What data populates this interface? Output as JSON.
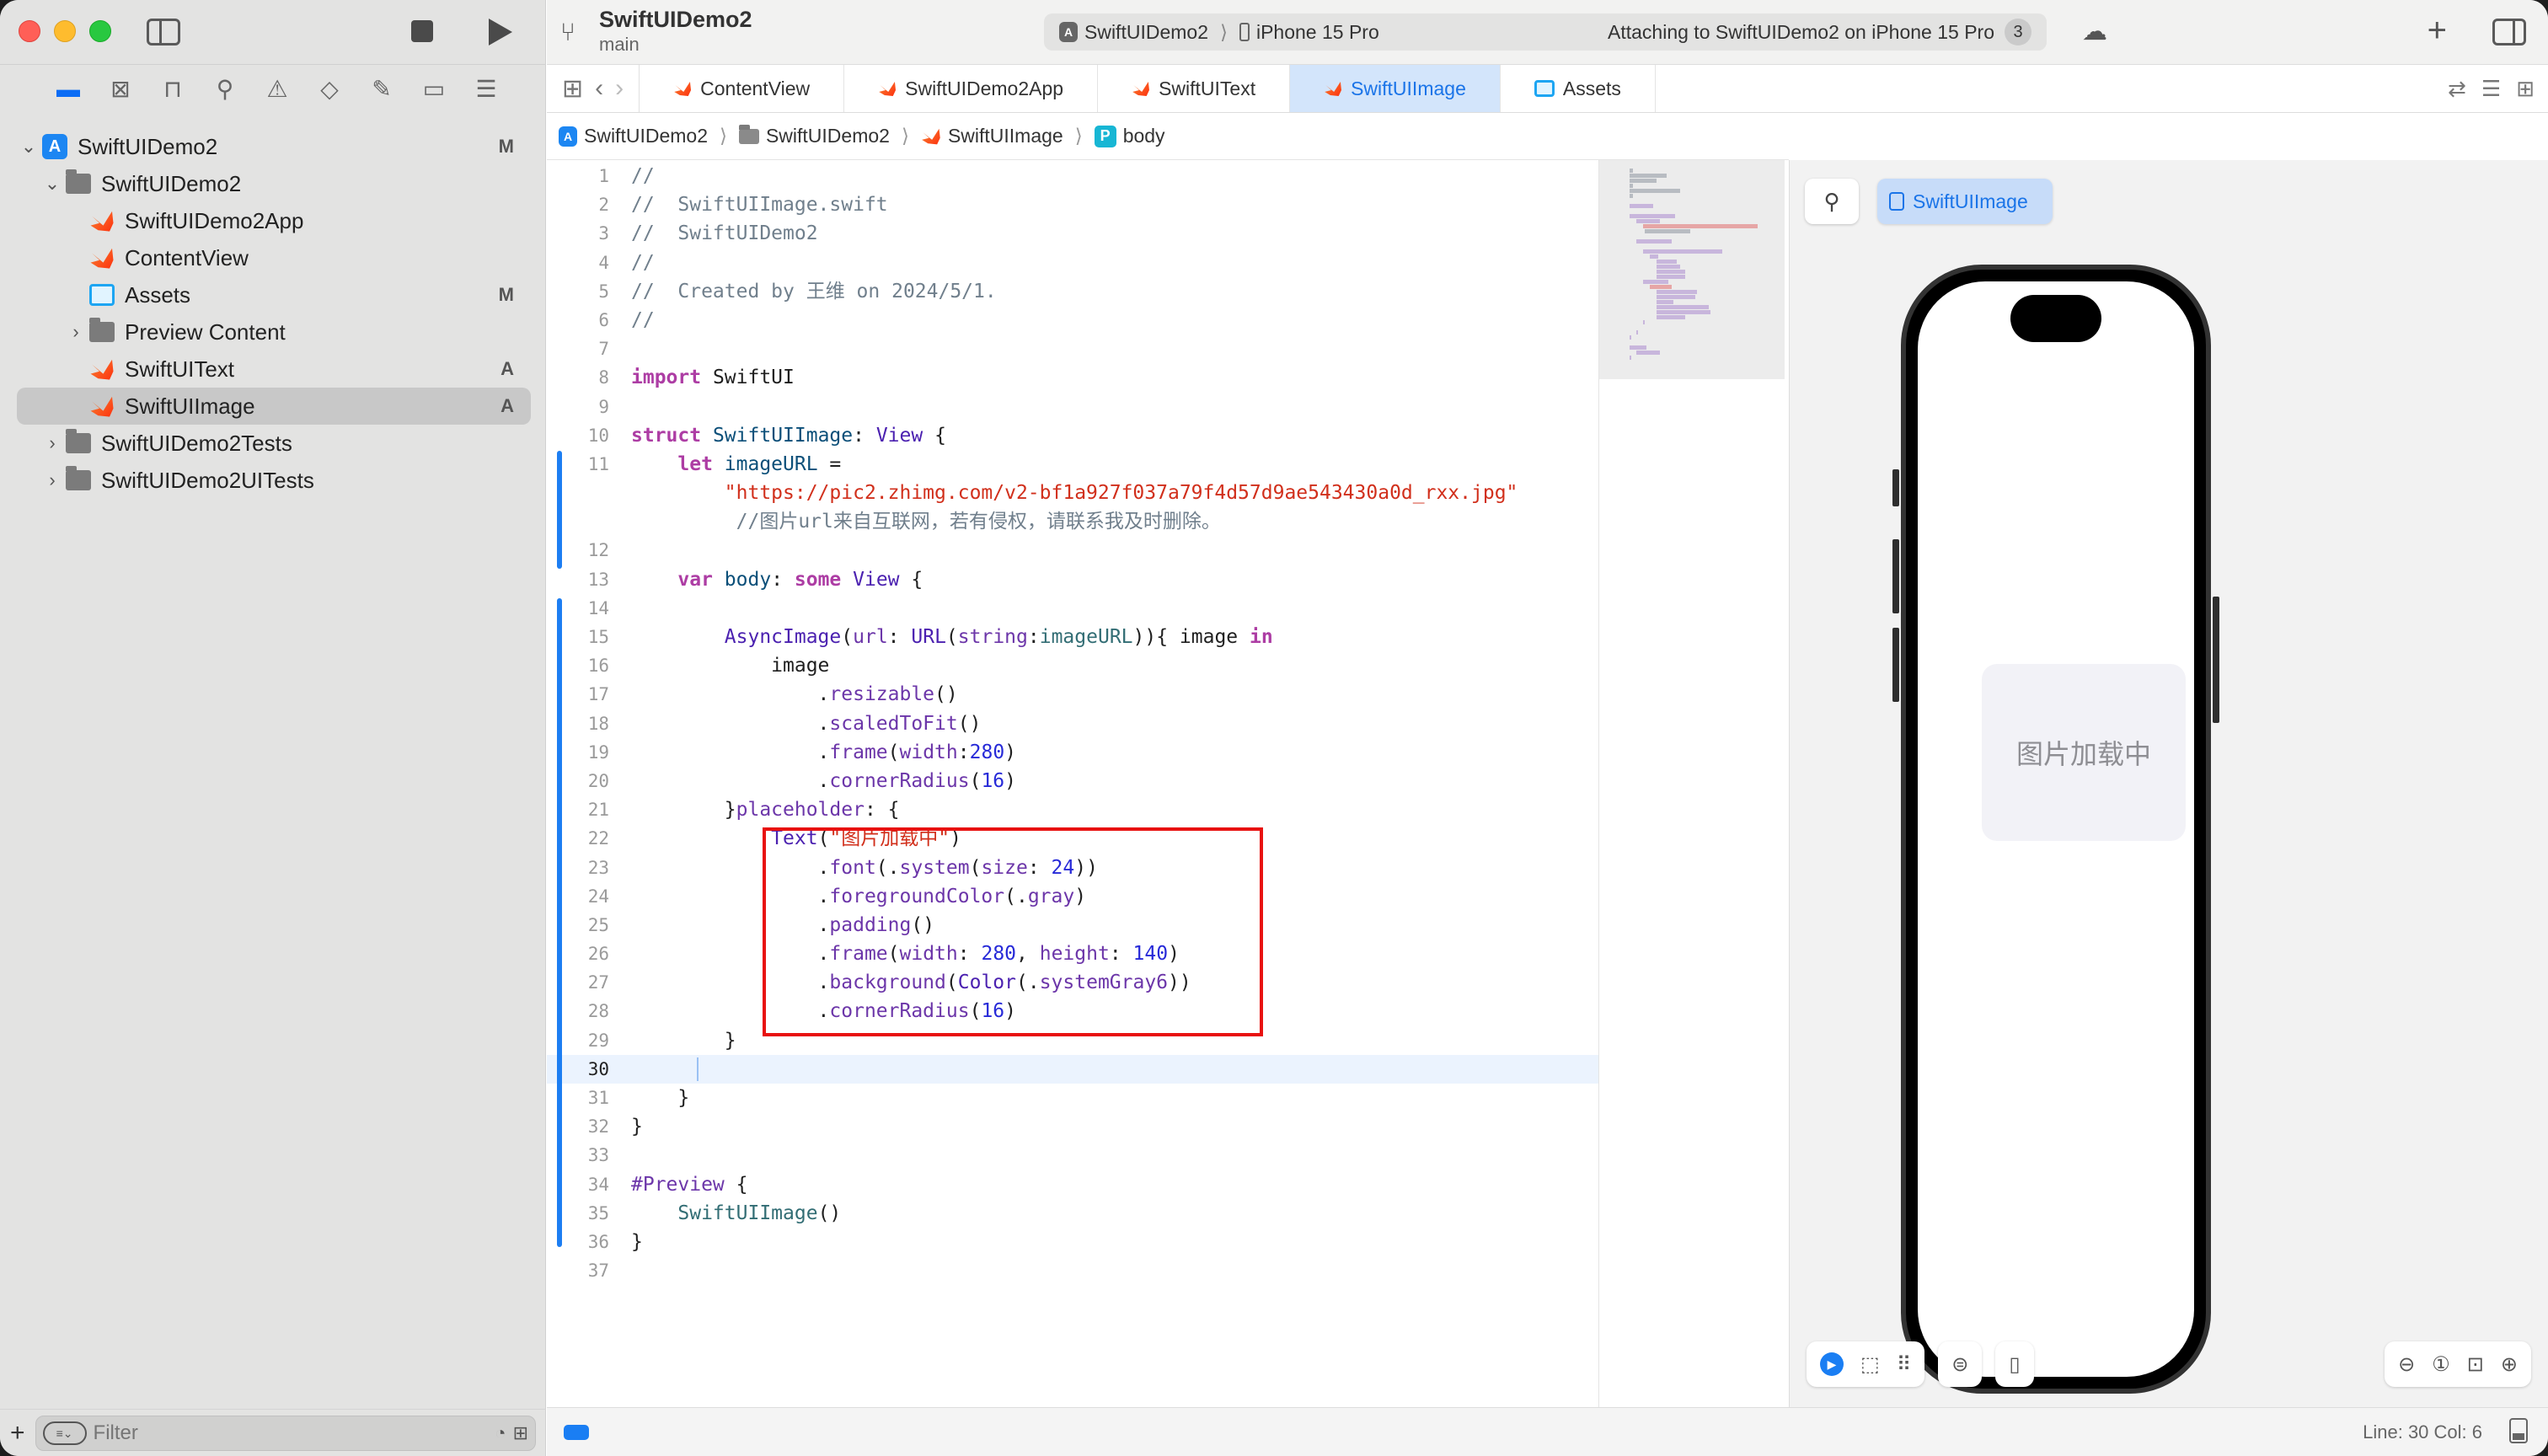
{
  "window": {
    "project_title": "SwiftUIDemo2",
    "branch": "main"
  },
  "toolbar": {
    "scheme": "SwiftUIDemo2",
    "destination": "iPhone 15 Pro",
    "status": "Attaching to SwiftUIDemo2 on iPhone 15 Pro",
    "status_count": "3"
  },
  "navigator": {
    "icons": [
      "folder-icon",
      "source-control-icon",
      "bookmark-icon",
      "search-icon",
      "warning-icon",
      "test-icon",
      "debug-icon",
      "breakpoint-icon",
      "report-icon"
    ],
    "tree": [
      {
        "label": "SwiftUIDemo2",
        "type": "project",
        "level": 0,
        "expanded": true,
        "badge": "M"
      },
      {
        "label": "SwiftUIDemo2",
        "type": "folder",
        "level": 1,
        "expanded": true,
        "badge": ""
      },
      {
        "label": "SwiftUIDemo2App",
        "type": "swift",
        "level": 2,
        "badge": ""
      },
      {
        "label": "ContentView",
        "type": "swift",
        "level": 2,
        "badge": ""
      },
      {
        "label": "Assets",
        "type": "assets",
        "level": 2,
        "badge": "M"
      },
      {
        "label": "Preview Content",
        "type": "folder",
        "level": 2,
        "expanded": false,
        "badge": ""
      },
      {
        "label": "SwiftUIText",
        "type": "swift",
        "level": 2,
        "badge": "A"
      },
      {
        "label": "SwiftUIImage",
        "type": "swift",
        "level": 2,
        "badge": "A",
        "selected": true
      },
      {
        "label": "SwiftUIDemo2Tests",
        "type": "folder",
        "level": 1,
        "expanded": false,
        "badge": ""
      },
      {
        "label": "SwiftUIDemo2UITests",
        "type": "folder",
        "level": 1,
        "expanded": false,
        "badge": ""
      }
    ],
    "filter_placeholder": "Filter"
  },
  "tabs": [
    {
      "label": "ContentView",
      "icon": "swift-icon"
    },
    {
      "label": "SwiftUIDemo2App",
      "icon": "swift-icon"
    },
    {
      "label": "SwiftUIText",
      "icon": "swift-icon"
    },
    {
      "label": "SwiftUIImage",
      "icon": "swift-icon",
      "active": true
    },
    {
      "label": "Assets",
      "icon": "assets-icon"
    }
  ],
  "breadcrumb": [
    "SwiftUIDemo2",
    "SwiftUIDemo2",
    "SwiftUIImage",
    "body"
  ],
  "editor": {
    "current_line": 30,
    "lines": [
      {
        "n": "1",
        "html": "<span class='k-cm'>//</span>"
      },
      {
        "n": "2",
        "html": "<span class='k-cm'>//  SwiftUIImage.swift</span>"
      },
      {
        "n": "3",
        "html": "<span class='k-cm'>//  SwiftUIDemo2</span>"
      },
      {
        "n": "4",
        "html": "<span class='k-cm'>//</span>"
      },
      {
        "n": "5",
        "html": "<span class='k-cm'>//  Created by 王维 on 2024/5/1.</span>"
      },
      {
        "n": "6",
        "html": "<span class='k-cm'>//</span>"
      },
      {
        "n": "7",
        "html": ""
      },
      {
        "n": "8",
        "html": "<span class='k-kw'>import</span> SwiftUI"
      },
      {
        "n": "9",
        "html": ""
      },
      {
        "n": "10",
        "html": "<span class='k-kw'>struct</span> <span class='k-decl'>SwiftUIImage</span>: <span class='k-type'>View</span> {"
      },
      {
        "n": "11",
        "html": "    <span class='k-kw'>let</span> <span class='k-decl'>imageURL</span> ="
      },
      {
        "n": "",
        "html": "        <span class='k-str'>\"https://pic2.zhimg.com/v2-bf1a927f037a79f4d57d9ae543430a0d_rxx.jpg\"</span>"
      },
      {
        "n": "",
        "html": "         <span class='k-cm'>//图片url来自互联网，若有侵权，请联系我及时删除。</span>"
      },
      {
        "n": "12",
        "html": ""
      },
      {
        "n": "13",
        "html": "    <span class='k-kw'>var</span> <span class='k-decl'>body</span>: <span class='k-kw'>some</span> <span class='k-type'>View</span> {"
      },
      {
        "n": "14",
        "html": ""
      },
      {
        "n": "15",
        "html": "        <span class='k-type'>AsyncImage</span>(<span class='k-fn'>url</span>: <span class='k-type'>URL</span>(<span class='k-fn'>string</span>:<span class='k-prop'>imageURL</span>)){ image <span class='k-kw'>in</span>"
      },
      {
        "n": "16",
        "html": "            image"
      },
      {
        "n": "17",
        "html": "                .<span class='k-fn'>resizable</span>()"
      },
      {
        "n": "18",
        "html": "                .<span class='k-fn'>scaledToFit</span>()"
      },
      {
        "n": "19",
        "html": "                .<span class='k-fn'>frame</span>(<span class='k-fn'>width</span>:<span class='k-num'>280</span>)"
      },
      {
        "n": "20",
        "html": "                .<span class='k-fn'>cornerRadius</span>(<span class='k-num'>16</span>)"
      },
      {
        "n": "21",
        "html": "        }<span class='k-fn'>placeholder</span>: {"
      },
      {
        "n": "22",
        "html": "            <span class='k-type'>Text</span>(<span class='k-str'>\"图片加载中\"</span>)"
      },
      {
        "n": "23",
        "html": "                .<span class='k-fn'>font</span>(.<span class='k-fn'>system</span>(<span class='k-fn'>size</span>: <span class='k-num'>24</span>))"
      },
      {
        "n": "24",
        "html": "                .<span class='k-fn'>foregroundColor</span>(.<span class='k-fn'>gray</span>)"
      },
      {
        "n": "25",
        "html": "                .<span class='k-fn'>padding</span>()"
      },
      {
        "n": "26",
        "html": "                .<span class='k-fn'>frame</span>(<span class='k-fn'>width</span>: <span class='k-num'>280</span>, <span class='k-fn'>height</span>: <span class='k-num'>140</span>)"
      },
      {
        "n": "27",
        "html": "                .<span class='k-fn'>background</span>(<span class='k-type'>Color</span>(.<span class='k-fn'>systemGray6</span>))"
      },
      {
        "n": "28",
        "html": "                .<span class='k-fn'>cornerRadius</span>(<span class='k-num'>16</span>)"
      },
      {
        "n": "29",
        "html": "        }"
      },
      {
        "n": "30",
        "html": ""
      },
      {
        "n": "31",
        "html": "    }"
      },
      {
        "n": "32",
        "html": "}"
      },
      {
        "n": "33",
        "html": ""
      },
      {
        "n": "34",
        "html": "<span class='k-fn'>#Preview</span> {"
      },
      {
        "n": "35",
        "html": "    <span class='k-prop'>SwiftUIImage</span>()"
      },
      {
        "n": "36",
        "html": "}"
      },
      {
        "n": "37",
        "html": ""
      }
    ]
  },
  "preview": {
    "chip_label": "SwiftUIImage",
    "placeholder_text": "图片加载中",
    "controls": [
      "live-play-icon",
      "select-icon",
      "variants-icon",
      "device-settings-icon",
      "device-icon"
    ],
    "zoom_controls": [
      "zoom-out-icon",
      "zoom-100-icon",
      "zoom-fit-icon",
      "zoom-in-icon"
    ]
  },
  "status": {
    "line_col": "Line: 30  Col: 6"
  },
  "colors": {
    "accent": "#1a74e8",
    "highlight_box": "#e8110f",
    "placeholder_bg": "#f2f2f7",
    "placeholder_fg": "#8e8e93"
  }
}
